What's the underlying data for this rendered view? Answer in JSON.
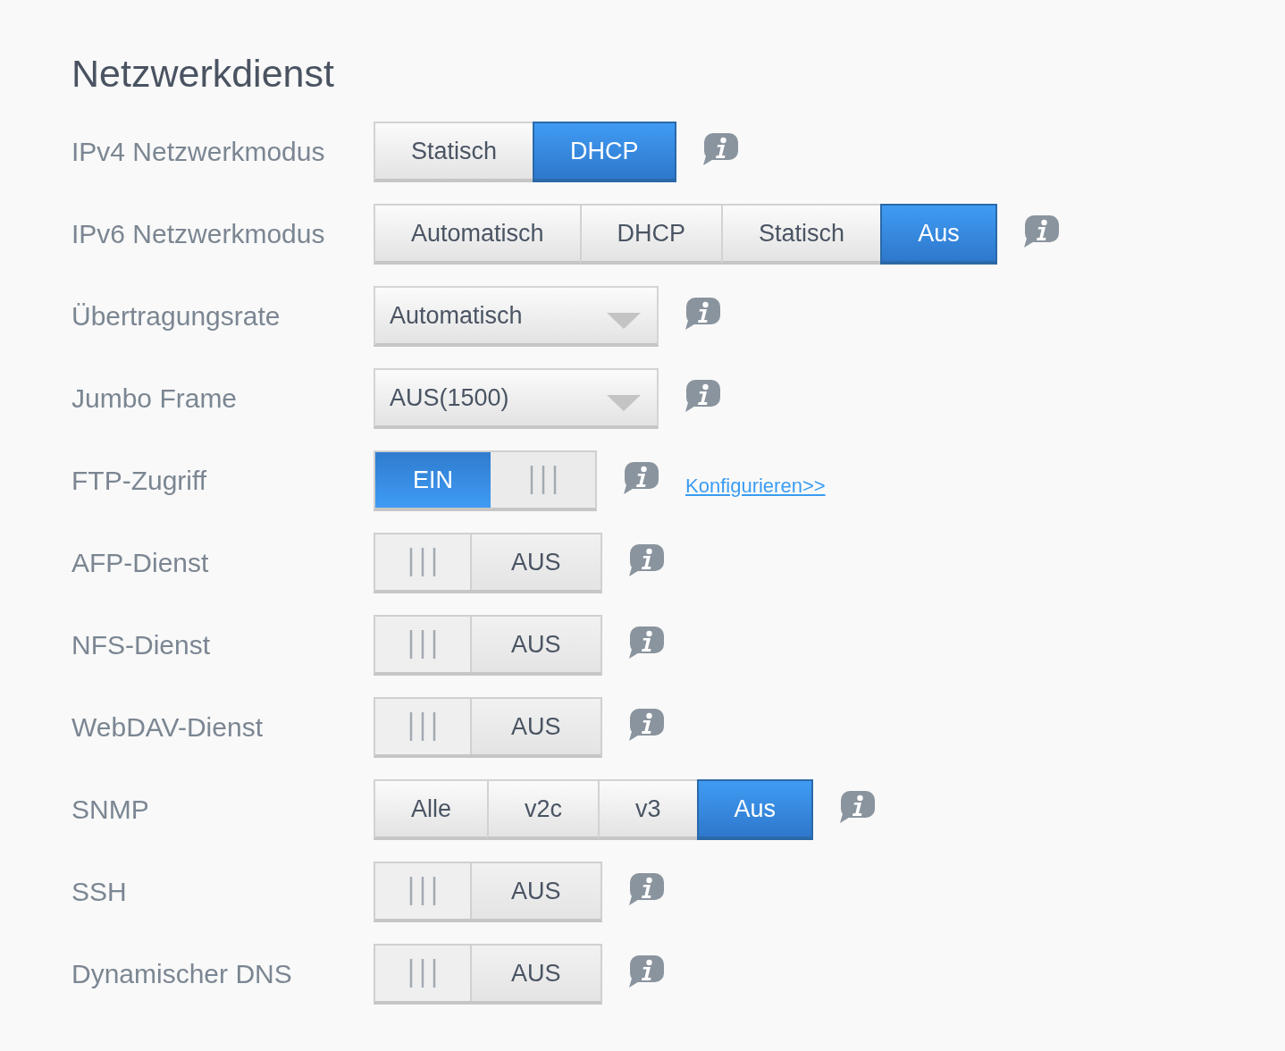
{
  "title": "Netzwerkdienst",
  "rows": [
    {
      "label": "IPv4 Netzwerkmodus",
      "kind": "segmented",
      "options": [
        {
          "label": "Statisch",
          "selected": false
        },
        {
          "label": "DHCP",
          "selected": true
        }
      ]
    },
    {
      "label": "IPv6 Netzwerkmodus",
      "kind": "segmented",
      "options": [
        {
          "label": "Automatisch",
          "selected": false
        },
        {
          "label": "DHCP",
          "selected": false
        },
        {
          "label": "Statisch",
          "selected": false
        },
        {
          "label": "Aus",
          "selected": true
        }
      ]
    },
    {
      "label": "Übertragungsrate",
      "kind": "select",
      "value": "Automatisch"
    },
    {
      "label": "Jumbo Frame",
      "kind": "select",
      "value": "AUS(1500)"
    },
    {
      "label": "FTP-Zugriff",
      "kind": "toggle",
      "on": true,
      "state_text": "EIN",
      "link": "Konfigurieren>>"
    },
    {
      "label": "AFP-Dienst",
      "kind": "toggle",
      "on": false,
      "state_text": "AUS"
    },
    {
      "label": "NFS-Dienst",
      "kind": "toggle",
      "on": false,
      "state_text": "AUS"
    },
    {
      "label": "WebDAV-Dienst",
      "kind": "toggle",
      "on": false,
      "state_text": "AUS"
    },
    {
      "label": "SNMP",
      "kind": "segmented",
      "options": [
        {
          "label": "Alle",
          "selected": false
        },
        {
          "label": "v2c",
          "selected": false
        },
        {
          "label": "v3",
          "selected": false
        },
        {
          "label": "Aus",
          "selected": true
        }
      ]
    },
    {
      "label": "SSH",
      "kind": "toggle",
      "on": false,
      "state_text": "AUS"
    },
    {
      "label": "Dynamischer DNS",
      "kind": "toggle",
      "on": false,
      "state_text": "AUS"
    }
  ]
}
